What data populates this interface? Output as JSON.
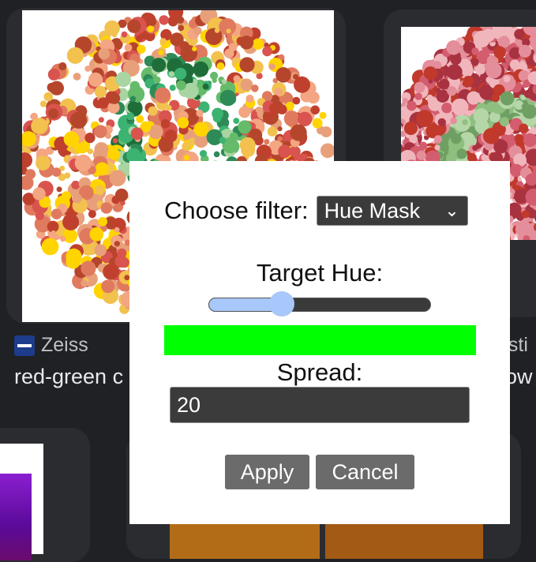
{
  "results": {
    "card1": {
      "source": "Zeiss",
      "title": "red-green c"
    },
    "card2": {
      "source_fragment": "nsti",
      "title_fragment": "ow"
    }
  },
  "dialog": {
    "filter_label": "Choose filter:",
    "filter_selected": "Hue Mask",
    "target_hue_label": "Target Hue:",
    "target_hue_value": 0.33,
    "preview_color": "#00ff00",
    "spread_label": "Spread:",
    "spread_value": "20",
    "apply_label": "Apply",
    "cancel_label": "Cancel"
  },
  "colors": {
    "page_bg": "#202124",
    "slider_accent": "#a8c7fa",
    "button_bg": "#6b6b6b"
  },
  "icons": {
    "source_logo": "zeiss-logo-icon",
    "dropdown": "chevron-down-icon"
  }
}
